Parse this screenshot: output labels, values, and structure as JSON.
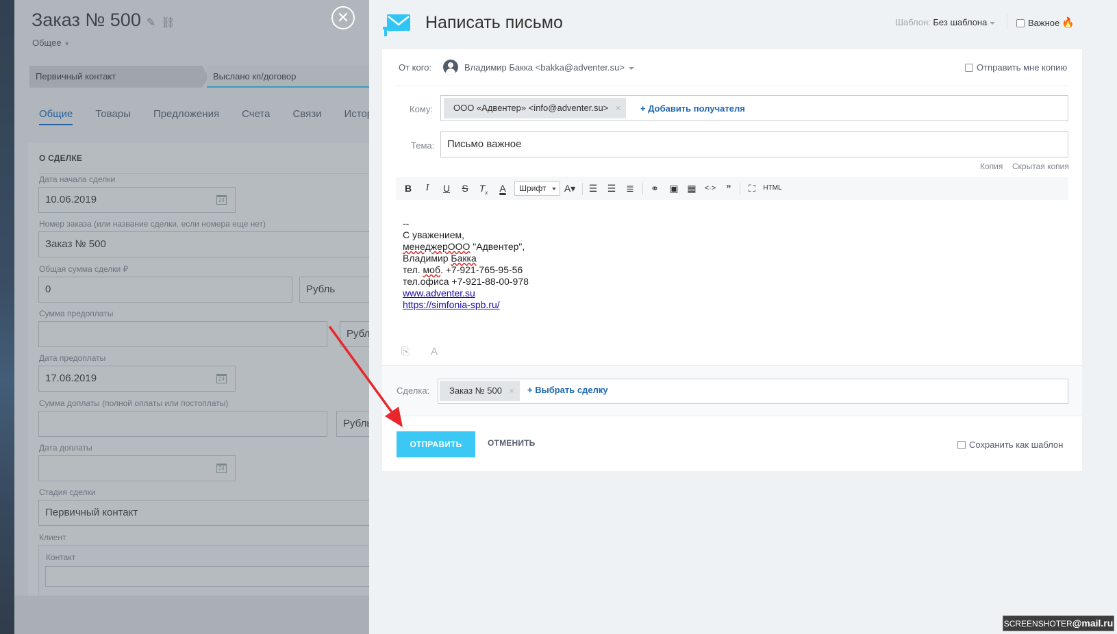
{
  "deal": {
    "title": "Заказ № 500",
    "category": "Общее",
    "stages": [
      "Первичный контакт",
      "Выслано кп/договор"
    ],
    "tabs": [
      "Общие",
      "Товары",
      "Предложения",
      "Счета",
      "Связи",
      "История"
    ],
    "section_title": "О СДЕЛКЕ",
    "fields": [
      {
        "label": "Дата начала сделки",
        "value": "10.06.2019"
      },
      {
        "label": "Номер заказа (или название сделки, если номера еще нет)",
        "value": "Заказ № 500"
      },
      {
        "label": "Общая сумма сделки ₽",
        "value": "0",
        "currency": "Рубль"
      },
      {
        "label": "Сумма предоплаты",
        "value": "",
        "currency": "Рубль"
      },
      {
        "label": "Дата предоплаты",
        "value": "17.06.2019"
      },
      {
        "label": "Сумма доплаты (полной оплаты или постоплаты)",
        "value": "",
        "currency": "Рубль"
      },
      {
        "label": "Дата доплаты",
        "value": ""
      },
      {
        "label": "Стадия сделки",
        "value": "Первичный контакт"
      },
      {
        "label": "Клиент",
        "value": ""
      },
      {
        "label": "Контакт",
        "value": ""
      }
    ]
  },
  "email": {
    "title": "Написать письмо",
    "template_label": "Шаблон:",
    "template_value": "Без шаблона",
    "important_label": "Важное",
    "from_label": "От кого:",
    "from_value": "Владимир Бакка <bakka@adventer.su>",
    "send_copy_label": "Отправить мне копию",
    "to_label": "Кому:",
    "recipient": "ООО «Адвентер» <info@adventer.su>",
    "add_recipient": "+ Добавить получателя",
    "subject_label": "Тема:",
    "subject_value": "Письмо важное",
    "cc_label": "Копия",
    "bcc_label": "Скрытая копия",
    "toolbar": {
      "font_label": "Шрифт",
      "html_label": "HTML"
    },
    "body_lines": {
      "l1": "--",
      "l2": "С уважением,",
      "l3a": "менеджерООО",
      "l3b": " \"Адвентер\",",
      "l4a": "Владимир ",
      "l4b": "Бакка",
      "l5a": "тел. ",
      "l5b": "моб",
      "l5c": ". +7-921-765-95-56",
      "l6": "тел.офиса +7-921-88-00-978",
      "l7": "www.adventer.su",
      "l8": "https://simfonia-spb.ru/"
    },
    "deal_label": "Сделка:",
    "deal_value": "Заказ № 500",
    "choose_deal": "+ Выбрать сделку",
    "send_label": "ОТПРАВИТЬ",
    "cancel_label": "ОТМЕНИТЬ",
    "save_template_label": "Сохранить как шаблон"
  },
  "watermark": {
    "a": "SCREENSHOTER",
    "b": "@mail.ru"
  },
  "colors": {
    "accent": "#3bc8f5",
    "link": "#2067b0",
    "arrow": "#e8262b"
  }
}
